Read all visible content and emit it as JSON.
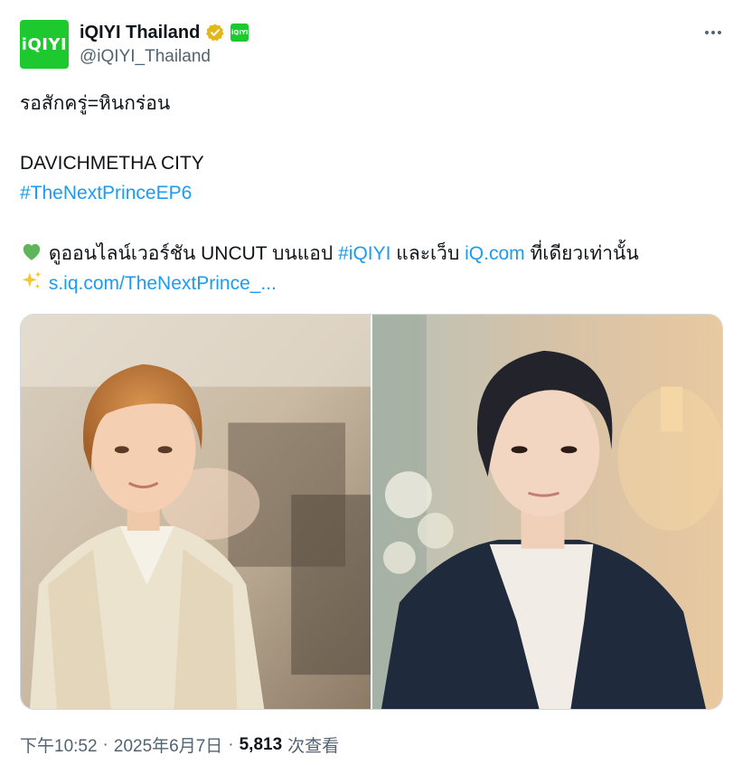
{
  "author": {
    "display_name": "iQIYI Thailand",
    "handle": "@iQIYI_Thailand",
    "avatar_text": "iQIYI",
    "affiliate_badge_text": "iQIYI"
  },
  "tweet": {
    "line1": "รอสักครู่=หินกร่อน",
    "line2": "DAVICHMETHA CITY",
    "hashtag1": "#TheNextPrinceEP6",
    "line4_prefix": " ดูออนไลน์เวอร์ชัน UNCUT บนแอป ",
    "hashtag2": "#iQIYI",
    "line4_mid": " และเว็บ ",
    "link1": "iQ.com",
    "line4_suffix": " ที่เดียวเท่านั้น",
    "link2": "s.iq.com/TheNextPrince_..."
  },
  "icons": {
    "heart": "green-heart-icon",
    "sparkles": "sparkles-icon",
    "verified": "verified-badge-icon",
    "more": "more-icon"
  },
  "meta": {
    "time": "下午10:52",
    "separator1": "·",
    "date": "2025年6月7日",
    "separator2": "·",
    "views": "5,813",
    "views_label": "次查看"
  },
  "colors": {
    "brand_green": "#1ec92f",
    "link_blue": "#1d9bf0",
    "verified_gold": "#e2b719"
  }
}
